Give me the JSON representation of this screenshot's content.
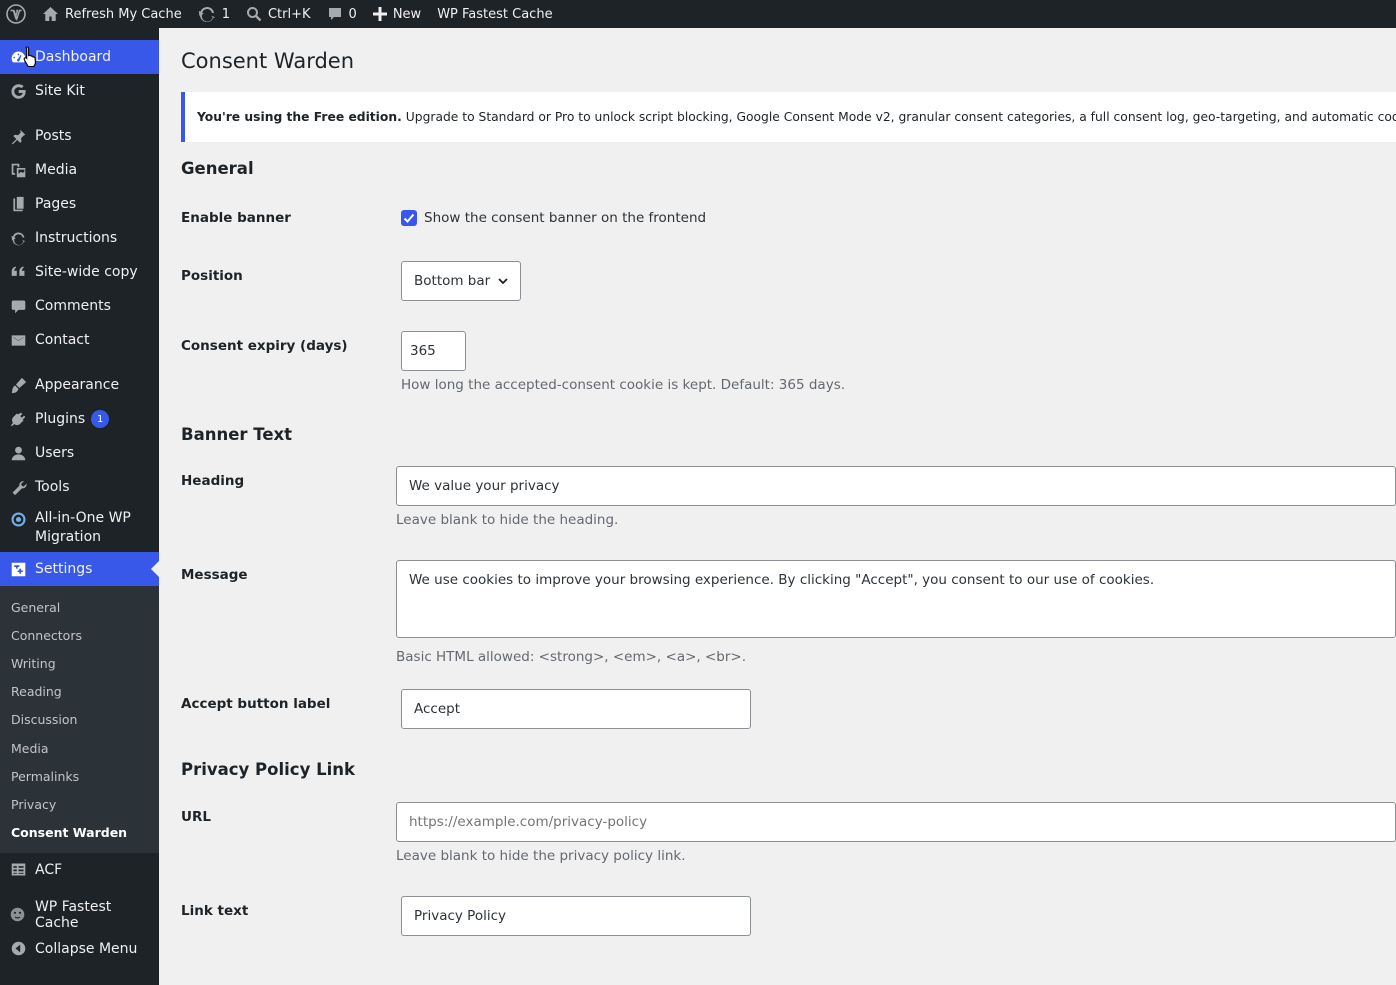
{
  "adminbar": {
    "site_name": "Refresh My Cache",
    "updates_count": "1",
    "search_shortcut": "Ctrl+K",
    "comments_count": "0",
    "new_label": "New",
    "plugin_label": "WP Fastest Cache"
  },
  "sidebar": {
    "items": [
      {
        "label": "Dashboard",
        "icon": "dashboard-icon"
      },
      {
        "label": "Site Kit",
        "icon": "google-icon"
      },
      {
        "label": "Posts",
        "icon": "pin-icon"
      },
      {
        "label": "Media",
        "icon": "media-icon"
      },
      {
        "label": "Pages",
        "icon": "pages-icon"
      },
      {
        "label": "Instructions",
        "icon": "refresh-icon"
      },
      {
        "label": "Site-wide copy",
        "icon": "quote-icon"
      },
      {
        "label": "Comments",
        "icon": "comment-icon"
      },
      {
        "label": "Contact",
        "icon": "mail-icon"
      },
      {
        "label": "Appearance",
        "icon": "brush-icon"
      },
      {
        "label": "Plugins",
        "icon": "plugin-icon",
        "badge": "1"
      },
      {
        "label": "Users",
        "icon": "user-icon"
      },
      {
        "label": "Tools",
        "icon": "wrench-icon"
      },
      {
        "label": "All-in-One WP Migration",
        "icon": "migration-icon"
      },
      {
        "label": "Settings",
        "icon": "settings-icon"
      },
      {
        "label": "ACF",
        "icon": "table-icon"
      },
      {
        "label": "WP Fastest Cache",
        "icon": "cheetah-icon"
      },
      {
        "label": "Collapse Menu",
        "icon": "collapse-icon"
      }
    ],
    "settings_submenu": [
      "General",
      "Connectors",
      "Writing",
      "Reading",
      "Discussion",
      "Media",
      "Permalinks",
      "Privacy",
      "Consent Warden"
    ]
  },
  "page": {
    "title": "Consent Warden",
    "notice_strong": "You're using the Free edition.",
    "notice_text": "Upgrade to Standard or Pro to unlock script blocking, Google Consent Mode v2, granular consent categories, a full consent log, geo-targeting, and automatic cookie scanning."
  },
  "general": {
    "heading": "General",
    "enable_label": "Enable banner",
    "enable_checkbox_text": "Show the consent banner on the frontend",
    "enable_checked": true,
    "position_label": "Position",
    "position_value": "Bottom bar",
    "expiry_label": "Consent expiry (days)",
    "expiry_value": "365",
    "expiry_desc": "How long the accepted-consent cookie is kept. Default: 365 days."
  },
  "banner_text": {
    "heading": "Banner Text",
    "heading_label": "Heading",
    "heading_value": "We value your privacy",
    "heading_desc": "Leave blank to hide the heading.",
    "message_label": "Message",
    "message_value": "We use cookies to improve your browsing experience. By clicking \"Accept\", you consent to our use of cookies.",
    "message_desc": "Basic HTML allowed: <strong>, <em>, <a>, <br>.",
    "accept_label": "Accept button label",
    "accept_value": "Accept"
  },
  "privacy_link": {
    "heading": "Privacy Policy Link",
    "url_label": "URL",
    "url_placeholder": "https://example.com/privacy-policy",
    "url_desc": "Leave blank to hide the privacy policy link.",
    "linktext_label": "Link text",
    "linktext_value": "Privacy Policy"
  },
  "colors": {
    "accent": "#3858e9",
    "sidebar_bg": "#1d2327",
    "content_bg": "#f0f0f1"
  }
}
